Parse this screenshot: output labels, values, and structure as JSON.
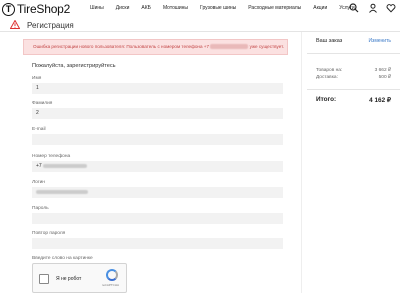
{
  "header": {
    "logo_mark": "T",
    "logo_text": "TireShop2",
    "nav": [
      "Шины",
      "Диски",
      "АКБ",
      "Мотошины",
      "Грузовые шины",
      "Расходные материалы",
      "Акции",
      "Услуги"
    ],
    "icons": [
      "search-icon",
      "user-icon",
      "heart-icon",
      "cart-icon"
    ]
  },
  "page": {
    "title": "Регистрация",
    "error_prefix": "Ошибка регистрации нового пользователя: Пользователь с номером телефона +7",
    "error_suffix": "уже существует."
  },
  "form": {
    "heading": "Пожалуйста, зарегистрируйтесь",
    "fields": [
      {
        "label": "Имя",
        "value": "1"
      },
      {
        "label": "Фамилия",
        "value": "2"
      },
      {
        "label": "E-mail",
        "value": ""
      },
      {
        "label": "Номер телефона",
        "value": "+7"
      },
      {
        "label": "Логин",
        "value": ""
      },
      {
        "label": "Пароль",
        "value": ""
      },
      {
        "label": "Повтор пароля",
        "value": ""
      }
    ],
    "captcha_label": "Введите слово на картинке",
    "captcha_checkbox": "Я не робот",
    "captcha_brand": "reCAPTCHA"
  },
  "sidebar": {
    "title": "Ваш заказ",
    "edit": "Изменить",
    "rows": [
      {
        "label": "Товаров на:",
        "value": "3 662 ₽"
      },
      {
        "label": "Доставка:",
        "value": "500 ₽"
      }
    ],
    "total_label": "Итого:",
    "total_value": "4 162 ₽"
  },
  "colors": {
    "accent": "#3d7bc8",
    "error_bg": "#fbe1e1",
    "error_text": "#c24444"
  }
}
